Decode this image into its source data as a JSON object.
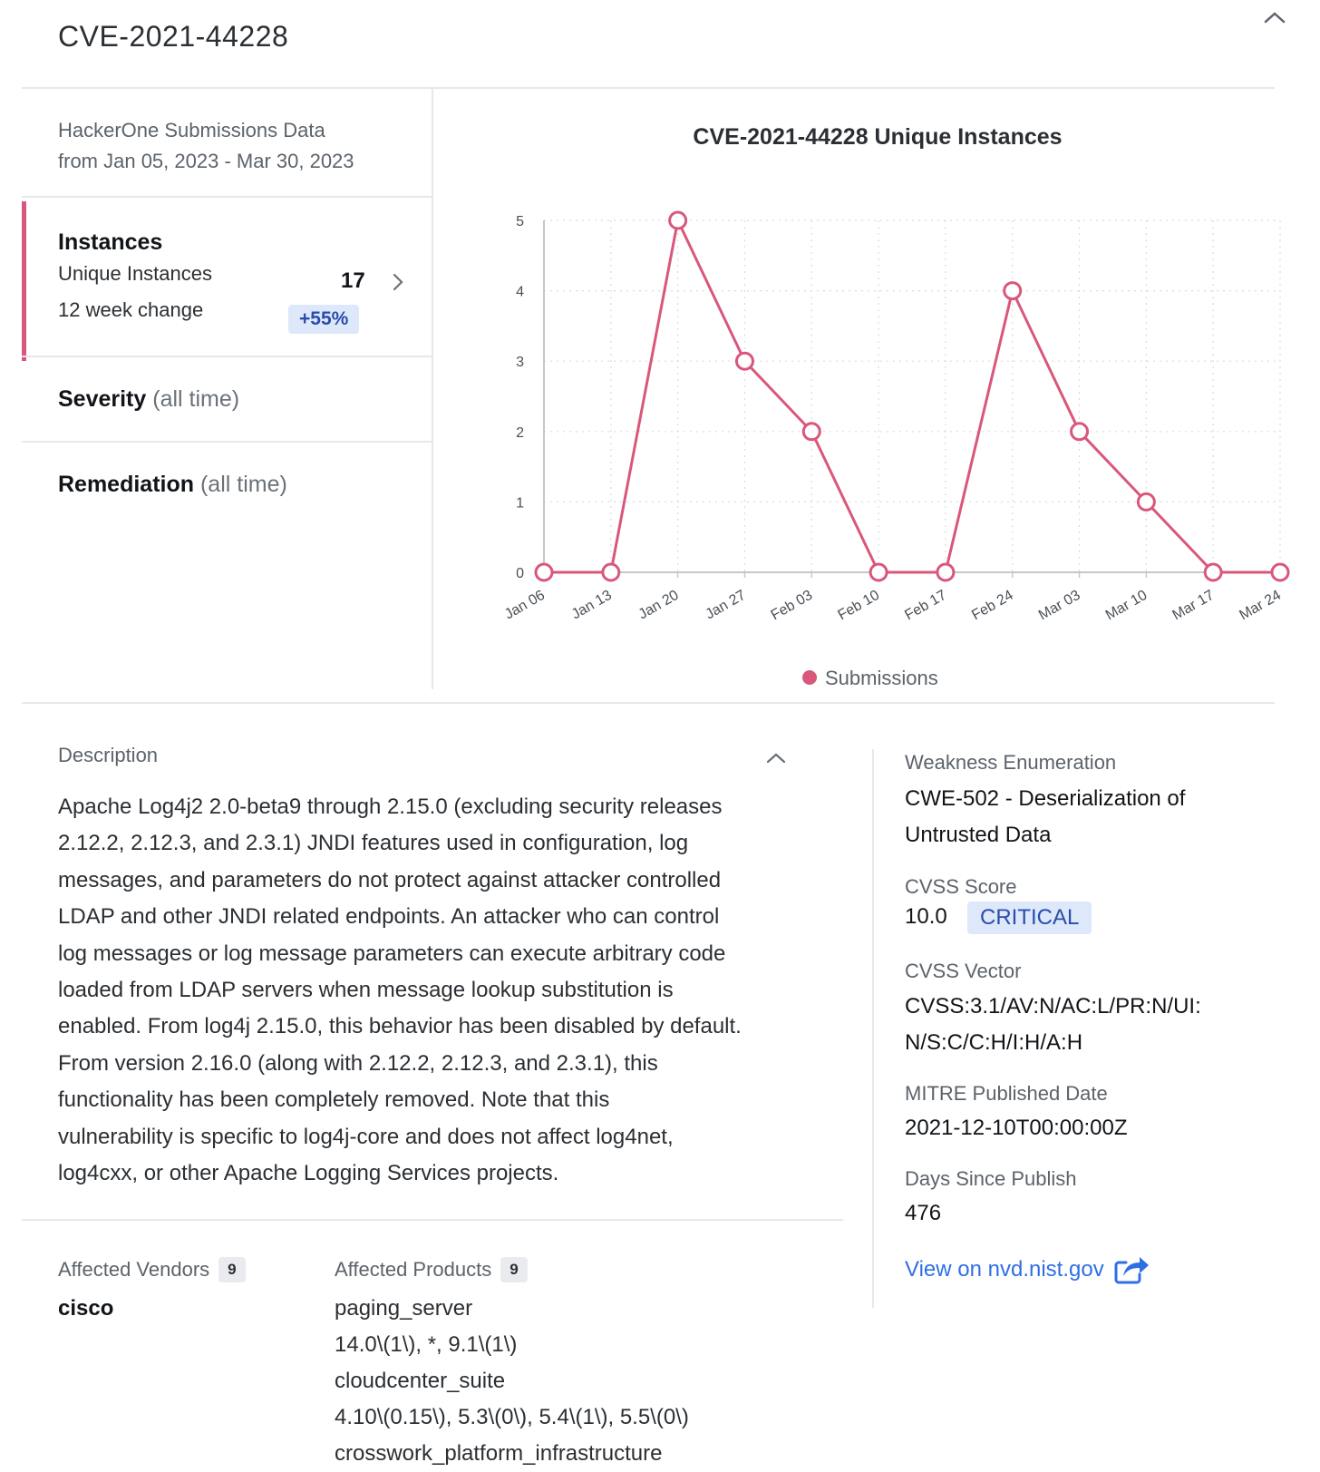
{
  "header": {
    "title": "CVE-2021-44228",
    "collapse_icon": "chevron-up-icon"
  },
  "submissions": {
    "line1": "HackerOne Submissions Data",
    "line2": "from Jan 05, 2023 - Mar 30, 2023"
  },
  "instances": {
    "title": "Instances",
    "unique_label": "Unique Instances",
    "unique_value": "17",
    "change_label": "12 week change",
    "change_value": "+55%"
  },
  "severity": {
    "label": "Severity",
    "qualifier": "(all time)"
  },
  "remediation": {
    "label": "Remediation",
    "qualifier": "(all time)"
  },
  "chart_data": {
    "type": "line",
    "title": "CVE-2021-44228 Unique Instances",
    "categories": [
      "Jan 06",
      "Jan 13",
      "Jan 20",
      "Jan 27",
      "Feb 03",
      "Feb 10",
      "Feb 17",
      "Feb 24",
      "Mar 03",
      "Mar 10",
      "Mar 17",
      "Mar 24"
    ],
    "series": [
      {
        "name": "Submissions",
        "color": "#d9577a",
        "values": [
          0,
          0,
          5,
          3,
          2,
          0,
          0,
          4,
          2,
          1,
          0,
          0
        ]
      }
    ],
    "ylim": [
      0,
      5
    ],
    "yticks": [
      "0",
      "1",
      "2",
      "3",
      "4",
      "5"
    ],
    "grid": true,
    "legend_position": "bottom"
  },
  "description": {
    "label": "Description",
    "lines": [
      "Apache Log4j2 2.0-beta9 through 2.15.0 (excluding security releases",
      "2.12.2, 2.12.3, and 2.3.1) JNDI features used in configuration, log",
      "messages, and parameters do not protect against attacker controlled",
      "LDAP and other JNDI related endpoints. An attacker who can control",
      "log messages or log message parameters can execute arbitrary code",
      "loaded from LDAP servers when message lookup substitution is",
      "enabled. From log4j 2.15.0, this behavior has been disabled by default.",
      "From version 2.16.0 (along with 2.12.2, 2.12.3, and 2.3.1), this",
      "functionality has been completely removed. Note that this",
      "vulnerability is specific to log4j-core and does not affect log4net,",
      "log4cxx, or other Apache Logging Services projects."
    ]
  },
  "details": {
    "weakness_label": "Weakness Enumeration",
    "weakness_line1": "CWE-502 - Deserialization of",
    "weakness_line2": "Untrusted Data",
    "cvss_score_label": "CVSS Score",
    "cvss_score": "10.0",
    "cvss_severity": "CRITICAL",
    "cvss_vector_label": "CVSS Vector",
    "cvss_vector_line1": "CVSS:3.1/AV:N/AC:L/PR:N/UI:",
    "cvss_vector_line2": "N/S:C/C:H/I:H/A:H",
    "published_label": "MITRE Published Date",
    "published_value": "2021-12-10T00:00:00Z",
    "days_label": "Days Since Publish",
    "days_value": "476",
    "link_label": "View on nvd.nist.gov",
    "link_icon": "external-share-icon"
  },
  "affected": {
    "vendors_label": "Affected Vendors",
    "vendors_count": "9",
    "vendors": [
      "cisco"
    ],
    "products_label": "Affected Products",
    "products_count": "9",
    "products": [
      {
        "name": "paging_server",
        "versions": "14.0\\(1\\),  *,  9.1\\(1\\)"
      },
      {
        "name": "cloudcenter_suite",
        "versions": "4.10\\(0.15\\),  5.3\\(0\\),  5.4\\(1\\),  5.5\\(0\\)"
      },
      {
        "name": "crosswork_platform_infrastructure",
        "versions": ""
      }
    ]
  }
}
